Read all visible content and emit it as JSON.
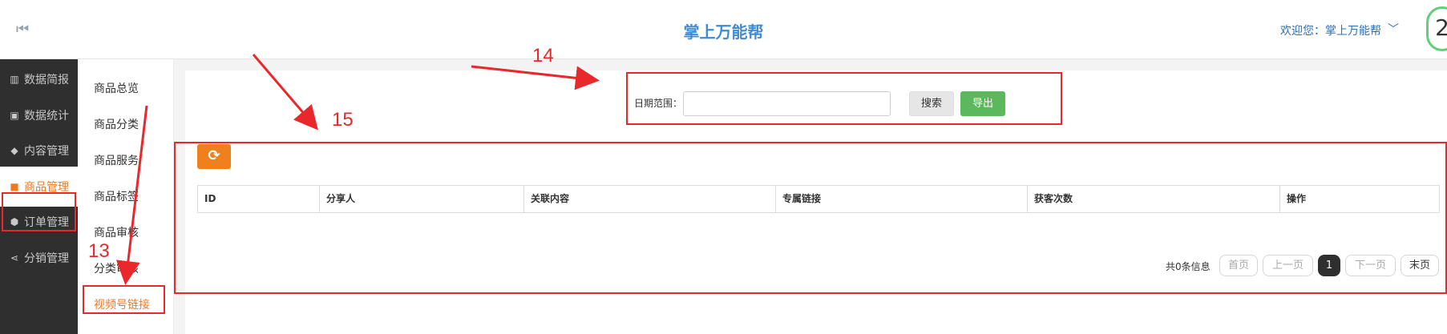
{
  "header": {
    "title": "掌上万能帮",
    "welcome": "欢迎您：掌上万能帮",
    "avatar_glyph": "2"
  },
  "sidebar": {
    "items": [
      {
        "label": "数据简报",
        "icon": "bar-chart-icon"
      },
      {
        "label": "数据统计",
        "icon": "money-icon"
      },
      {
        "label": "内容管理",
        "icon": "tag-icon"
      },
      {
        "label": "商品管理",
        "icon": "shopping-bag-icon",
        "active": true
      },
      {
        "label": "订单管理",
        "icon": "cube-icon"
      },
      {
        "label": "分销管理",
        "icon": "share-icon"
      }
    ]
  },
  "subnav": {
    "items": [
      {
        "label": "商品总览"
      },
      {
        "label": "商品分类"
      },
      {
        "label": "商品服务"
      },
      {
        "label": "商品标签"
      },
      {
        "label": "商品审核"
      },
      {
        "label": "分类审核"
      },
      {
        "label": "视频号链接",
        "active": true
      }
    ]
  },
  "filter": {
    "date_label": "日期范围：",
    "date_value": "",
    "search_label": "搜索",
    "export_label": "导出"
  },
  "table": {
    "columns": [
      "ID",
      "分享人",
      "关联内容",
      "专属链接",
      "获客次数",
      "操作"
    ],
    "rows": []
  },
  "pager": {
    "info": "共0条信息",
    "first": "首页",
    "prev": "上一页",
    "current": "1",
    "next": "下一页",
    "last": "末页"
  },
  "annotations": {
    "n13": "13",
    "n14": "14",
    "n15": "15"
  },
  "colors": {
    "accent": "#f0781f",
    "title_blue": "#3f8bd6",
    "sidebar_bg": "#2f2f2f",
    "export_green": "#5cb85c",
    "annotation_red": "#e8282b"
  }
}
